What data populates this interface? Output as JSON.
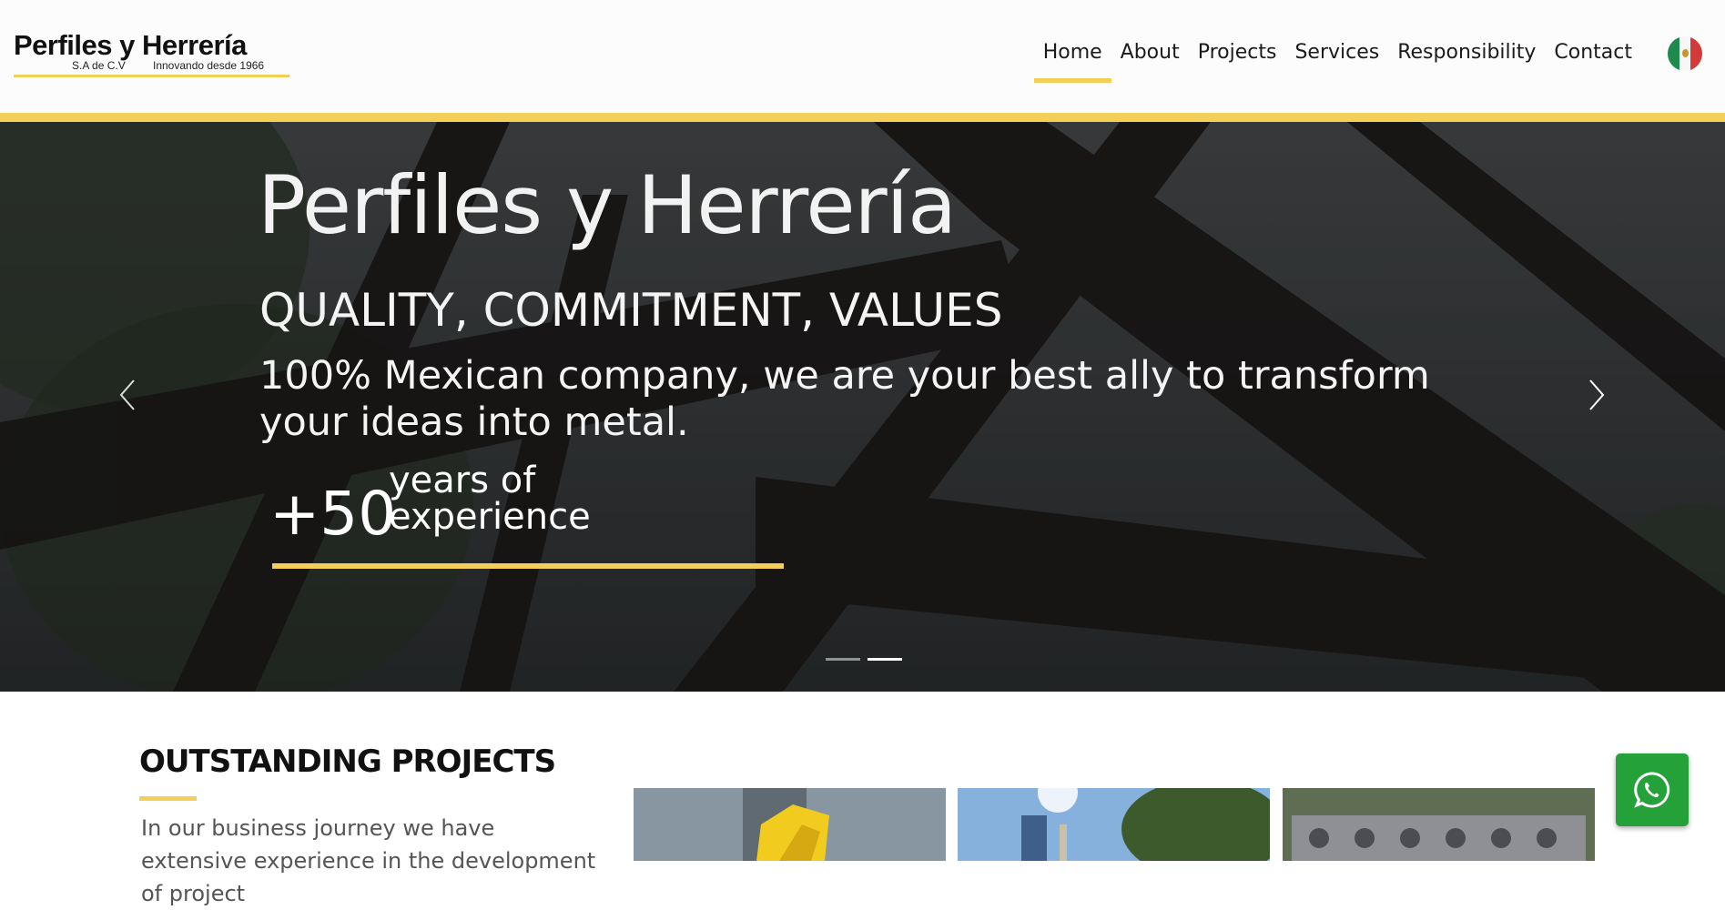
{
  "header": {
    "logo": {
      "title": "Perfiles y Herrería",
      "subtitle_left": "S.A de C.V",
      "subtitle_right": "Innovando desde 1966"
    },
    "nav": [
      {
        "label": "Home",
        "active": true
      },
      {
        "label": "About",
        "active": false
      },
      {
        "label": "Projects",
        "active": false
      },
      {
        "label": "Services",
        "active": false
      },
      {
        "label": "Responsibility",
        "active": false
      },
      {
        "label": "Contact",
        "active": false
      }
    ],
    "language_flag": "mexico-flag-icon"
  },
  "hero": {
    "title": "Perfiles y Herrería",
    "subtitle": "QUALITY, COMMITMENT, VALUES",
    "description": "100% Mexican company, we are your best ally to transform your ideas into metal.",
    "experience_number": "+50",
    "experience_text_1": "years of",
    "experience_text_2": "experience",
    "slides_count": 2,
    "active_slide": 2
  },
  "projects": {
    "title": "OUTSTANDING PROJECTS",
    "text": "In our business journey we have extensive experience in the development of project"
  },
  "whatsapp": {
    "icon": "whatsapp-icon"
  },
  "colors": {
    "accent": "#f3cf5a",
    "whatsapp": "#25a13a",
    "hero_overlay": "#3e4143"
  }
}
